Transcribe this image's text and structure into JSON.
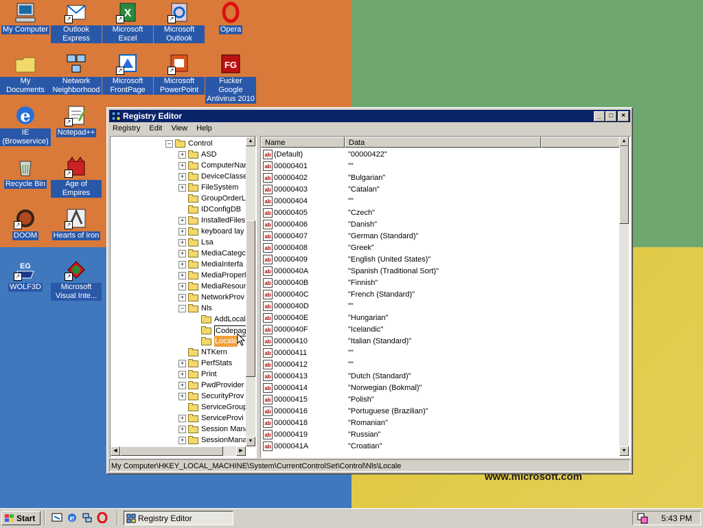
{
  "desktop": {
    "icons": [
      {
        "label": "My Computer"
      },
      {
        "label": "Outlook Express"
      },
      {
        "label": "Microsoft Excel"
      },
      {
        "label": "Microsoft Outlook"
      },
      {
        "label": "Opera"
      },
      {
        "label": "My Documents"
      },
      {
        "label": "Network Neighborhood"
      },
      {
        "label": "Microsoft FrontPage"
      },
      {
        "label": "Microsoft PowerPoint"
      },
      {
        "label": "Fucker Google Antivirus 2010"
      },
      {
        "label": "IE (Browservice)"
      },
      {
        "label": "Notepad++"
      },
      {
        "label": "Recycle Bin"
      },
      {
        "label": "Age of Empires"
      },
      {
        "label": "DOOM"
      },
      {
        "label": "Hearts of Iron"
      },
      {
        "label": "WOLF3D"
      },
      {
        "label": "Microsoft Visual Inte..."
      }
    ],
    "wallpaper_text": "www.microsoft.com",
    "colors": {
      "orange": "#d97a3a",
      "green": "#6fa86f",
      "blue": "#3f78bd",
      "yellow": "#e0c63a"
    }
  },
  "window": {
    "title": "Registry Editor",
    "menu": [
      "Registry",
      "Edit",
      "View",
      "Help"
    ],
    "tree": [
      {
        "label": "Control",
        "expander": "-"
      },
      {
        "label": "ASD",
        "expander": "+"
      },
      {
        "label": "ComputerNar",
        "expander": "+"
      },
      {
        "label": "DeviceClasse",
        "expander": "+"
      },
      {
        "label": "FileSystem",
        "expander": "+"
      },
      {
        "label": "GroupOrderL",
        "expander": ""
      },
      {
        "label": "IDConfigDB",
        "expander": ""
      },
      {
        "label": "InstalledFiles",
        "expander": "+"
      },
      {
        "label": "keyboard lay",
        "expander": "+"
      },
      {
        "label": "Lsa",
        "expander": "+"
      },
      {
        "label": "MediaCategc",
        "expander": "+"
      },
      {
        "label": "MediaInterfa",
        "expander": "+"
      },
      {
        "label": "MediaProperl",
        "expander": "+"
      },
      {
        "label": "MediaResour",
        "expander": "+"
      },
      {
        "label": "NetworkProv",
        "expander": "+"
      },
      {
        "label": "Nls",
        "expander": "-"
      },
      {
        "label": "AddLocal",
        "expander": ""
      },
      {
        "label": "Codepage",
        "expander": ""
      },
      {
        "label": "Locale",
        "expander": ""
      },
      {
        "label": "NTKern",
        "expander": ""
      },
      {
        "label": "PerfStats",
        "expander": "+"
      },
      {
        "label": "Print",
        "expander": "+"
      },
      {
        "label": "PwdProvider",
        "expander": "+"
      },
      {
        "label": "SecurityProv",
        "expander": "+"
      },
      {
        "label": "ServiceGroup",
        "expander": ""
      },
      {
        "label": "ServiceProvi",
        "expander": "+"
      },
      {
        "label": "Session Mana",
        "expander": "+"
      },
      {
        "label": "SessionMana",
        "expander": "+"
      }
    ],
    "columns": {
      "name": "Name",
      "data": "Data"
    },
    "values": [
      {
        "name": "(Default)",
        "data": "\"00000422\""
      },
      {
        "name": "00000401",
        "data": "\"\""
      },
      {
        "name": "00000402",
        "data": "\"Bulgarian\""
      },
      {
        "name": "00000403",
        "data": "\"Catalan\""
      },
      {
        "name": "00000404",
        "data": "\"\""
      },
      {
        "name": "00000405",
        "data": "\"Czech\""
      },
      {
        "name": "00000406",
        "data": "\"Danish\""
      },
      {
        "name": "00000407",
        "data": "\"German (Standard)\""
      },
      {
        "name": "00000408",
        "data": "\"Greek\""
      },
      {
        "name": "00000409",
        "data": "\"English (United States)\""
      },
      {
        "name": "0000040A",
        "data": "\"Spanish (Traditional Sort)\""
      },
      {
        "name": "0000040B",
        "data": "\"Finnish\""
      },
      {
        "name": "0000040C",
        "data": "\"French (Standard)\""
      },
      {
        "name": "0000040D",
        "data": "\"\""
      },
      {
        "name": "0000040E",
        "data": "\"Hungarian\""
      },
      {
        "name": "0000040F",
        "data": "\"Icelandic\""
      },
      {
        "name": "00000410",
        "data": "\"Italian (Standard)\""
      },
      {
        "name": "00000411",
        "data": "\"\""
      },
      {
        "name": "00000412",
        "data": "\"\""
      },
      {
        "name": "00000413",
        "data": "\"Dutch (Standard)\""
      },
      {
        "name": "00000414",
        "data": "\"Norwegian (Bokmal)\""
      },
      {
        "name": "00000415",
        "data": "\"Polish\""
      },
      {
        "name": "00000416",
        "data": "\"Portuguese (Brazilian)\""
      },
      {
        "name": "00000418",
        "data": "\"Romanian\""
      },
      {
        "name": "00000419",
        "data": "\"Russian\""
      },
      {
        "name": "0000041A",
        "data": "\"Croatian\""
      }
    ],
    "status": "My Computer\\HKEY_LOCAL_MACHINE\\System\\CurrentControlSet\\Control\\Nls\\Locale"
  },
  "taskbar": {
    "start_label": "Start",
    "task_label": "Registry Editor",
    "clock": "5:43 PM"
  }
}
